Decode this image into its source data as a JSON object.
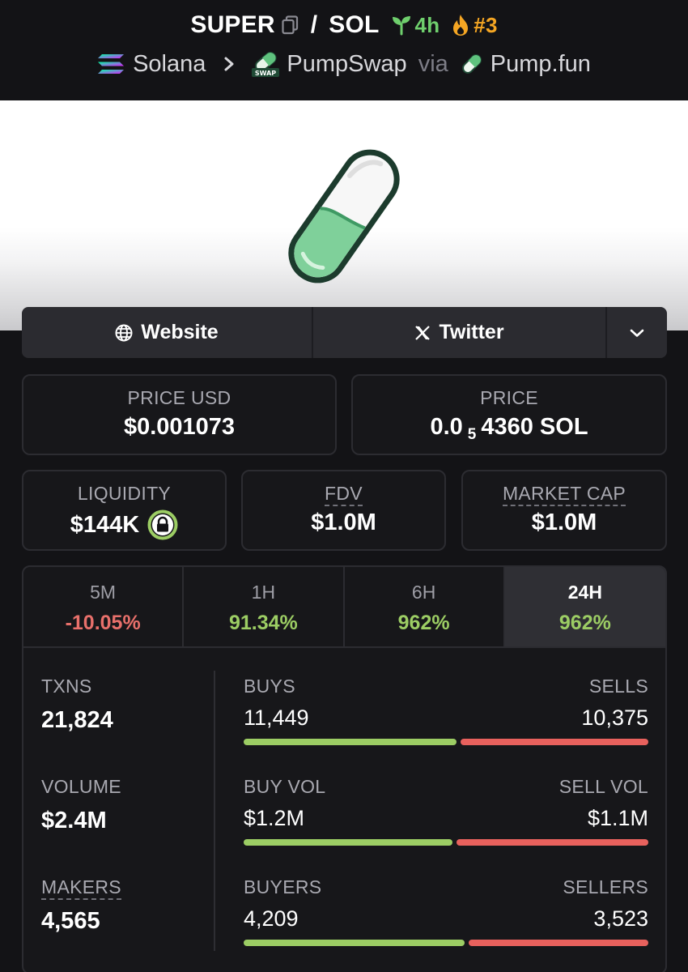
{
  "header": {
    "base_token": "SUPER",
    "slash": "/",
    "quote_token": "SOL",
    "age": "4h",
    "rank": "#3",
    "chain": "Solana",
    "dex": "PumpSwap",
    "via": "via",
    "launchpad": "Pump.fun",
    "swap_badge": "SWAP"
  },
  "links": {
    "website": "Website",
    "twitter": "Twitter"
  },
  "prices": {
    "price_usd_label": "PRICE USD",
    "price_usd": "$0.001073",
    "price_label": "PRICE",
    "price_prefix": "0.0",
    "price_zeros": "5",
    "price_suffix": "4360 SOL"
  },
  "metrics": {
    "liquidity_label": "LIQUIDITY",
    "liquidity": "$144K",
    "fdv_label": "FDV",
    "fdv": "$1.0M",
    "mcap_label": "MARKET CAP",
    "mcap": "$1.0M"
  },
  "periods": [
    {
      "label": "5M",
      "change": "-10.05%"
    },
    {
      "label": "1H",
      "change": "91.34%"
    },
    {
      "label": "6H",
      "change": "962%"
    },
    {
      "label": "24H",
      "change": "962%"
    }
  ],
  "stats": {
    "txns_label": "TXNS",
    "txns": "21,824",
    "volume_label": "VOLUME",
    "volume": "$2.4M",
    "makers_label": "MAKERS",
    "makers": "4,565",
    "buys_label": "BUYS",
    "buys": "11,449",
    "buys_fraction": 0.525,
    "sells_label": "SELLS",
    "sells": "10,375",
    "buyvol_label": "BUY VOL",
    "buyvol": "$1.2M",
    "buyvol_fraction": 0.515,
    "sellvol_label": "SELL VOL",
    "sellvol": "$1.1M",
    "buyers_label": "BUYERS",
    "buyers": "4,209",
    "buyers_fraction": 0.545,
    "sellers_label": "SELLERS",
    "sellers": "3,523"
  },
  "colors": {
    "positive": "#9ccd64",
    "negative": "#e8706b",
    "sell_bar": "#e8615d",
    "background": "#131316"
  }
}
